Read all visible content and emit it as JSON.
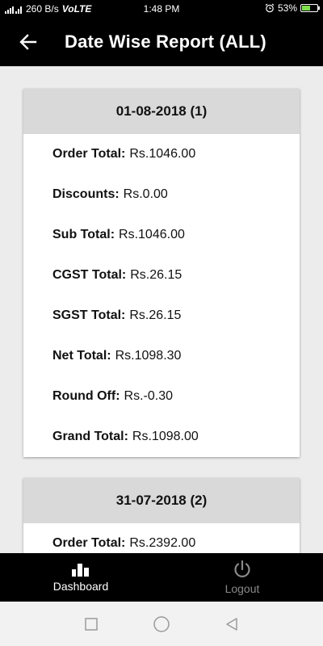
{
  "status_bar": {
    "network_speed": "260 B/s",
    "network_type": "VoLTE",
    "time": "1:48 PM",
    "battery_percent": "53%",
    "battery_level": 0.53
  },
  "app_bar": {
    "title": "Date Wise Report (ALL)"
  },
  "reports": [
    {
      "header": "01-08-2018 (1)",
      "rows": [
        {
          "label": "Order Total:",
          "value": "Rs.1046.00"
        },
        {
          "label": "Discounts:",
          "value": "Rs.0.00"
        },
        {
          "label": "Sub Total:",
          "value": "Rs.1046.00"
        },
        {
          "label": "CGST Total:",
          "value": "Rs.26.15"
        },
        {
          "label": "SGST Total:",
          "value": "Rs.26.15"
        },
        {
          "label": "Net Total:",
          "value": "Rs.1098.30"
        },
        {
          "label": "Round Off:",
          "value": "Rs.-0.30"
        },
        {
          "label": "Grand Total:",
          "value": "Rs.1098.00"
        }
      ]
    },
    {
      "header": "31-07-2018 (2)",
      "rows": [
        {
          "label": "Order Total:",
          "value": "Rs.2392.00"
        }
      ]
    }
  ],
  "bottom_nav": {
    "items": [
      {
        "label": "Dashboard",
        "icon": "bar-chart-icon"
      },
      {
        "label": "Logout",
        "icon": "power-icon"
      }
    ]
  },
  "colors": {
    "app_bar": "#000000",
    "card_header": "#d9d9d9",
    "battery_fill": "#7ee04a",
    "nav_inactive": "#8a8a8a"
  }
}
